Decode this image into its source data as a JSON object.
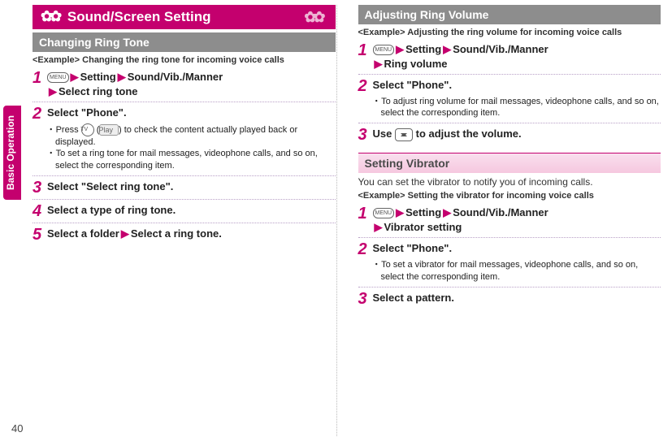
{
  "header": {
    "title": "Sound/Screen Setting"
  },
  "sidetab": "Basic Operation",
  "pagenum": "40",
  "left": {
    "sec1_title": "Changing Ring Tone",
    "sec1_example": "<Example> Changing the ring tone for incoming voice calls",
    "s1": {
      "menu_label": "MENU",
      "a": "Setting",
      "b": "Sound/Vib./Manner",
      "c": "Select ring tone"
    },
    "s2": {
      "title": "Select \"Phone\".",
      "n1_press": "Press",
      "n1_play": "Play",
      "n1_rest": "to check the content actually played back or displayed.",
      "n2": "To set a ring tone for mail messages, videophone calls, and so on, select the corresponding item."
    },
    "s3": "Select \"Select ring tone\".",
    "s4": "Select a type of ring tone.",
    "s5_a": "Select a folder",
    "s5_b": "Select a ring tone."
  },
  "right": {
    "secA_title": "Adjusting Ring Volume",
    "secA_example": "<Example> Adjusting the ring volume for incoming voice calls",
    "A1": {
      "menu_label": "MENU",
      "a": "Setting",
      "b": "Sound/Vib./Manner",
      "c": "Ring volume"
    },
    "A2": {
      "title": "Select \"Phone\".",
      "n1": "To adjust ring volume for mail messages, videophone calls, and so on, select the corresponding item."
    },
    "A3_a": "Use",
    "A3_b": "to adjust the volume.",
    "secB_title": "Setting Vibrator",
    "secB_body": "You can set the vibrator to notify you of incoming calls.",
    "secB_example": "<Example> Setting the vibrator for incoming voice calls",
    "B1": {
      "menu_label": "MENU",
      "a": "Setting",
      "b": "Sound/Vib./Manner",
      "c": "Vibrator setting"
    },
    "B2": {
      "title": "Select \"Phone\".",
      "n1": "To set a vibrator for mail messages, videophone calls, and so on, select the corresponding item."
    },
    "B3": "Select a pattern."
  }
}
